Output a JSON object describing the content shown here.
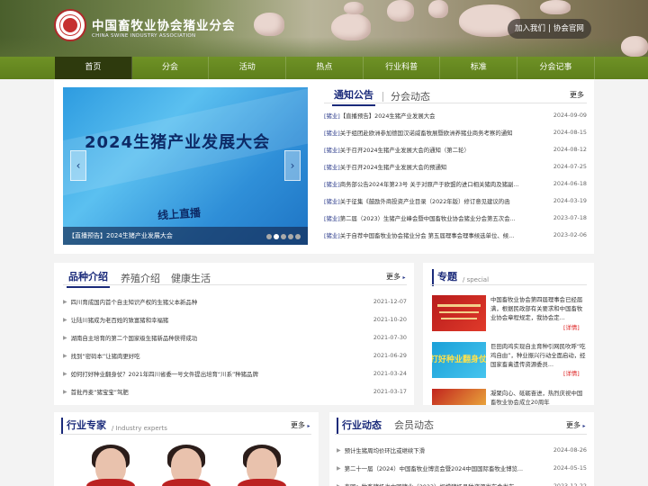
{
  "header": {
    "site_title": "中国畜牧业协会猪业分会",
    "site_subtitle": "CHINA SWINE INDUSTRY ASSOCIATION",
    "join_label": "加入我们",
    "join_sep": "|",
    "official_label": "协会官网"
  },
  "nav": {
    "items": [
      "首页",
      "分会",
      "活动",
      "热点",
      "行业科普",
      "标准",
      "分会记事"
    ],
    "active_index": 0
  },
  "banner": {
    "title": "2024生猪产业发展大会",
    "live_text": "线上直播",
    "caption": "【直播预告】2024生猪产业发展大会",
    "prev_icon": "‹",
    "next_icon": "›",
    "dot_count": 5,
    "active_dot": 1
  },
  "notice": {
    "tab_main": "通知公告",
    "tab_other": "分会动态",
    "more": "更多",
    "items": [
      {
        "tag": "[猪业]",
        "title": "【直播预告】2024生猪产业发展大会",
        "date": "2024-09-09"
      },
      {
        "tag": "[猪业]",
        "title": "关于组团赴欧洲参加德国汉诺威畜牧展暨欧洲养猪业商务考察的通知",
        "date": "2024-08-15"
      },
      {
        "tag": "[猪业]",
        "title": "关于召开2024生猪产业发展大会的通知（第二轮）",
        "date": "2024-08-12"
      },
      {
        "tag": "[猪业]",
        "title": "关于召开2024生猪产业发展大会的预通知",
        "date": "2024-07-25"
      },
      {
        "tag": "[猪业]",
        "title": "商务部公告2024年第23号 关于对原产于欧盟的进口相关猪肉及猪副...",
        "date": "2024-06-18"
      },
      {
        "tag": "[猪业]",
        "title": "关于征集《鼓励外商投资产业目录（2022年版）修订意见建议的函",
        "date": "2024-03-19"
      },
      {
        "tag": "[猪业]",
        "title": "第二届（2023）生猪产业峰会暨中国畜牧业协会猪业分会第五次会...",
        "date": "2023-07-18"
      },
      {
        "tag": "[猪业]",
        "title": "关于自荐中国畜牧业协会猪业分会 第五届理事会理事候选单位、候...",
        "date": "2023-02-06"
      }
    ]
  },
  "breeds": {
    "tab_main": "品种介绍",
    "tab_2": "养殖介绍",
    "tab_3": "健康生活",
    "more": "更多",
    "items": [
      {
        "title": "四川育成国内首个自主知识产权的生猪父本新品种",
        "date": "2021-12-07"
      },
      {
        "title": "让陆川猪成为老百姓的致富猪和幸福猪",
        "date": "2021-10-20"
      },
      {
        "title": "湖南自主培育的第二个国家级生猪新品种获得成功",
        "date": "2021-07-30"
      },
      {
        "title": "找到“密码本”让猪肉更好吃",
        "date": "2021-06-29"
      },
      {
        "title": "如何打好种业翻身仗？2021年四川省委一号文件提出培育“川系”种猪品牌",
        "date": "2021-03-24"
      },
      {
        "title": "首批丹麦“猪宝宝”驾肥",
        "date": "2021-03-17"
      }
    ]
  },
  "special": {
    "tab_main": "专题",
    "tab_sub": "/ special",
    "items": [
      {
        "text": "中国畜牧业协会第四届理事会已经届满，根据民政部有关要求和中国畜牧业协会章程规定，我协会定...",
        "detail": "[详情]"
      },
      {
        "text": "巨田肉鸡实现自主育种引网民吹呼“吃鸡自由”，种业振兴行动全面启动，经国家畜禽遗传资源委员...",
        "detail": "[详情]"
      },
      {
        "text": "凝聚向心、砥砺奋进，热烈庆祝中国畜牧业协会成立20周年",
        "detail": ""
      }
    ],
    "thumb2_text": "打好种业翻身仗"
  },
  "experts": {
    "tab_main": "行业专家",
    "tab_sub": "/ Industry experts",
    "more": "更多"
  },
  "industry_news": {
    "tab_main": "行业动态",
    "tab_other": "会员动态",
    "more": "更多",
    "items": [
      {
        "title": "预计生猪周均价环比或继续下滑",
        "date": "2024-08-26"
      },
      {
        "title": "第二十一届（2024）中国畜牧业博览会暨2024中国国际畜牧业博览...",
        "date": "2024-05-15"
      },
      {
        "title": "泰国：牧畜猪场也中国猪业（2023）规模猪场品种资源发布会发布...",
        "date": "2023-12-22"
      }
    ]
  },
  "colors": {
    "nav_green": "#6f9226",
    "nav_active": "#2e3a0d",
    "title_blue": "#1a2a7a",
    "detail_red": "#dd2222"
  }
}
